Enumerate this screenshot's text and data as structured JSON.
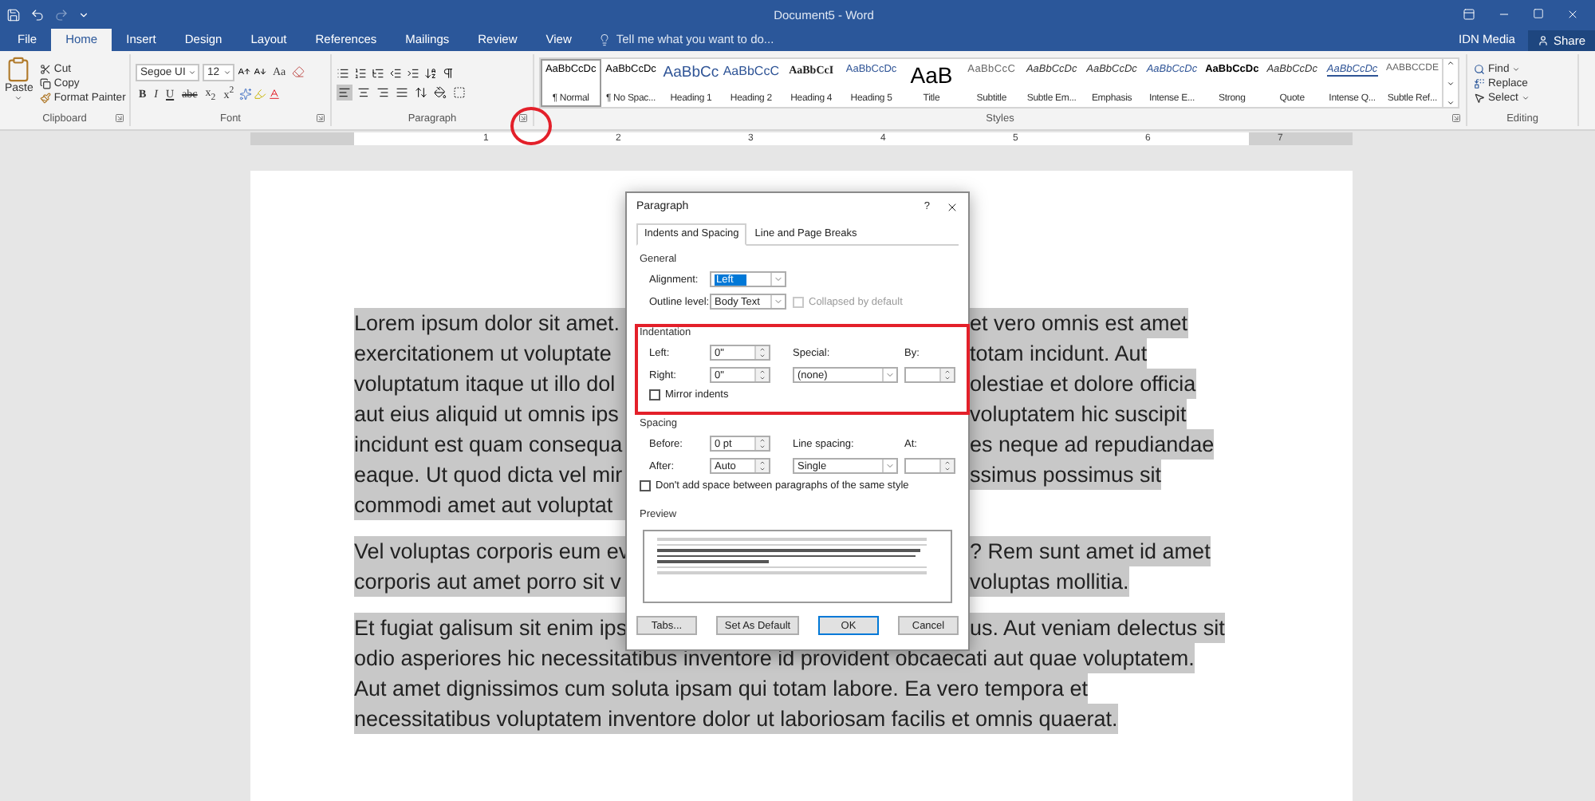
{
  "title_bar": {
    "title": "Document5 - Word"
  },
  "tabs": [
    {
      "label": "File",
      "selected": false
    },
    {
      "label": "Home",
      "selected": true
    },
    {
      "label": "Insert",
      "selected": false
    },
    {
      "label": "Design",
      "selected": false
    },
    {
      "label": "Layout",
      "selected": false
    },
    {
      "label": "References",
      "selected": false
    },
    {
      "label": "Mailings",
      "selected": false
    },
    {
      "label": "Review",
      "selected": false
    },
    {
      "label": "View",
      "selected": false
    }
  ],
  "tell_me": {
    "placeholder": "Tell me what you want to do..."
  },
  "account": {
    "user": "IDN Media",
    "share": "Share"
  },
  "ribbon": {
    "clipboard": {
      "label": "Clipboard",
      "paste": "Paste",
      "cut": "Cut",
      "copy": "Copy",
      "format_painter": "Format Painter"
    },
    "font": {
      "label": "Font",
      "font_name": "Segoe UI",
      "font_size": "12",
      "change_case": "Aa",
      "bold": "B",
      "italic": "I",
      "underline": "U",
      "strikethrough": "abc",
      "subscript": "x$_{2}$",
      "superscript": "x$^{2}$"
    },
    "paragraph": {
      "label": "Paragraph"
    },
    "styles": {
      "label": "Styles",
      "items": [
        {
          "preview": "AaBbCcDc",
          "label": "¶ Normal",
          "kind": "normal",
          "selected": true
        },
        {
          "preview": "AaBbCcDc",
          "label": "¶ No Spac...",
          "kind": "normal",
          "selected": false
        },
        {
          "preview": "AaBbCc",
          "label": "Heading 1",
          "kind": "heading",
          "selected": false
        },
        {
          "preview": "AaBbCcC",
          "label": "Heading 2",
          "kind": "heading2",
          "selected": false
        },
        {
          "preview": "AaBbCcI",
          "label": "Heading 4",
          "kind": "heading4",
          "selected": false
        },
        {
          "preview": "AaBbCcDc",
          "label": "Heading 5",
          "kind": "heading5",
          "selected": false
        },
        {
          "preview": "AaB",
          "label": "Title",
          "kind": "title",
          "selected": false
        },
        {
          "preview": "AaBbCcC",
          "label": "Subtitle",
          "kind": "subtitle",
          "selected": false
        },
        {
          "preview": "AaBbCcDc",
          "label": "Subtle Em...",
          "kind": "emphasis",
          "selected": false
        },
        {
          "preview": "AaBbCcDc",
          "label": "Emphasis",
          "kind": "emphasis",
          "selected": false
        },
        {
          "preview": "AaBbCcDc",
          "label": "Intense E...",
          "kind": "intense",
          "selected": false
        },
        {
          "preview": "AaBbCcDc",
          "label": "Strong",
          "kind": "strong",
          "selected": false
        },
        {
          "preview": "AaBbCcDc",
          "label": "Quote",
          "kind": "emphasis",
          "selected": false
        },
        {
          "preview": "AaBbCcDc",
          "label": "Intense Q...",
          "kind": "intense_quote",
          "selected": false
        },
        {
          "preview": "AABBCCDE",
          "label": "Subtle Ref...",
          "kind": "reference",
          "selected": false
        }
      ]
    },
    "editing": {
      "label": "Editing",
      "find": "Find",
      "replace": "Replace",
      "select": "Select"
    }
  },
  "ruler": {
    "marks": [
      "1",
      "2",
      "3",
      "4",
      "5",
      "6",
      "7"
    ]
  },
  "document": {
    "paragraphs": [
      {
        "lines": [
          {
            "kind": "split",
            "left": "Lorem ipsum dolor sit amet.",
            "right": "et vero omnis est amet"
          },
          {
            "kind": "split",
            "left": "exercitationem ut voluptate",
            "right": "totam incidunt. Aut"
          },
          {
            "kind": "split",
            "left": "voluptatum itaque ut illo dol",
            "right": "olestiae et dolore officia"
          },
          {
            "kind": "split",
            "left": "aut eius aliquid ut omnis ips",
            "right": "voluptatem hic suscipit"
          },
          {
            "kind": "split",
            "left": "incidunt est quam consequa",
            "right": "es neque ad repudiandae"
          },
          {
            "kind": "split",
            "left": "eaque. Ut quod dicta vel mir",
            "right": "ssimus possimus sit"
          },
          {
            "kind": "split",
            "left": "commodi amet aut voluptat"
          }
        ]
      },
      {
        "lines": [
          {
            "kind": "split",
            "left": "Vel voluptas corporis eum ev",
            "right": "? Rem sunt amet id amet"
          },
          {
            "kind": "split",
            "left": "corporis aut amet porro sit v",
            "right": "voluptas mollitia."
          }
        ]
      },
      {
        "lines": [
          {
            "kind": "split",
            "left": "Et fugiat galisum sit enim ips",
            "right": "us. Aut veniam delectus sit"
          },
          {
            "kind": "full",
            "text": "odio asperiores hic necessitatibus inventore id provident obcaecati aut quae voluptatem."
          },
          {
            "kind": "full",
            "text": "Aut amet dignissimos cum soluta ipsam qui totam labore. Ea vero tempora et"
          },
          {
            "kind": "full",
            "text": "necessitatibus voluptatem inventore dolor ut laboriosam facilis et omnis quaerat."
          }
        ]
      }
    ]
  },
  "dialog": {
    "title": "Paragraph",
    "help": "?",
    "tabs": [
      {
        "label": "Indents and Spacing",
        "selected": true
      },
      {
        "label": "Line and Page Breaks",
        "selected": false
      }
    ],
    "general": {
      "heading": "General",
      "alignment": {
        "label": "Alignment:",
        "value": "Left",
        "highlighted": true
      },
      "outline_level": {
        "label": "Outline level:",
        "value": "Body Text"
      },
      "collapsed": {
        "label": "Collapsed by default",
        "checked": false,
        "disabled": true
      }
    },
    "indentation": {
      "heading": "Indentation",
      "left": {
        "label": "Left:",
        "value": "0\""
      },
      "right": {
        "label": "Right:",
        "value": "0\""
      },
      "special": {
        "label": "Special:",
        "value": "(none)"
      },
      "by": {
        "label": "By:"
      },
      "mirror": {
        "label": "Mirror indents",
        "checked": false
      }
    },
    "spacing": {
      "heading": "Spacing",
      "before": {
        "label": "Before:",
        "value": "0 pt"
      },
      "after": {
        "label": "After:",
        "value": "Auto"
      },
      "line_spacing": {
        "label": "Line spacing:",
        "value": "Single"
      },
      "at": {
        "label": "At:"
      },
      "dont_add": {
        "label": "Don't add space between paragraphs of the same style",
        "checked": false
      }
    },
    "preview": {
      "heading": "Preview"
    },
    "buttons": [
      {
        "label": "Tabs...",
        "default": false
      },
      {
        "label": "Set As Default",
        "default": false
      },
      {
        "label": "OK",
        "default": true
      },
      {
        "label": "Cancel",
        "default": false
      }
    ]
  }
}
